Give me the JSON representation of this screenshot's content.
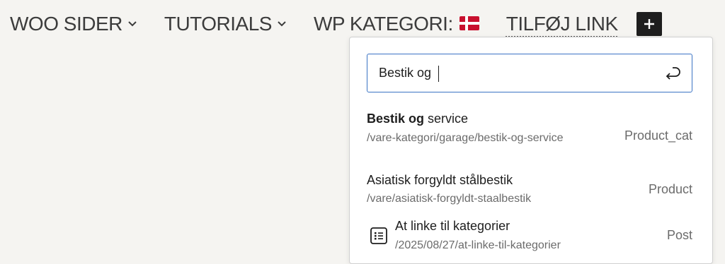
{
  "nav": {
    "items": [
      {
        "label": "WOO SIDER"
      },
      {
        "label": "TUTORIALS"
      },
      {
        "label": "WP KATEGORI:"
      },
      {
        "label": "TILFØJ LINK"
      }
    ],
    "flag_icon": "denmark-flag-icon",
    "plus_icon": "plus-icon"
  },
  "search": {
    "value": "Bestik og",
    "submit_icon": "enter-icon",
    "accent_color": "#3a73c4"
  },
  "results": [
    {
      "title_bold": "Bestik og",
      "title_rest": " service",
      "url": "/vare-kategori/garage/bestik-og-service",
      "type": "Product_cat"
    },
    {
      "title": "Asiatisk forgyldt stålbestik",
      "url": "/vare/asiatisk-forgyldt-staalbestik",
      "type": "Product"
    },
    {
      "icon": "post-list-icon",
      "title": "At linke til kategorier",
      "url": "/2025/08/27/at-linke-til-kategorier",
      "type": "Post"
    }
  ]
}
